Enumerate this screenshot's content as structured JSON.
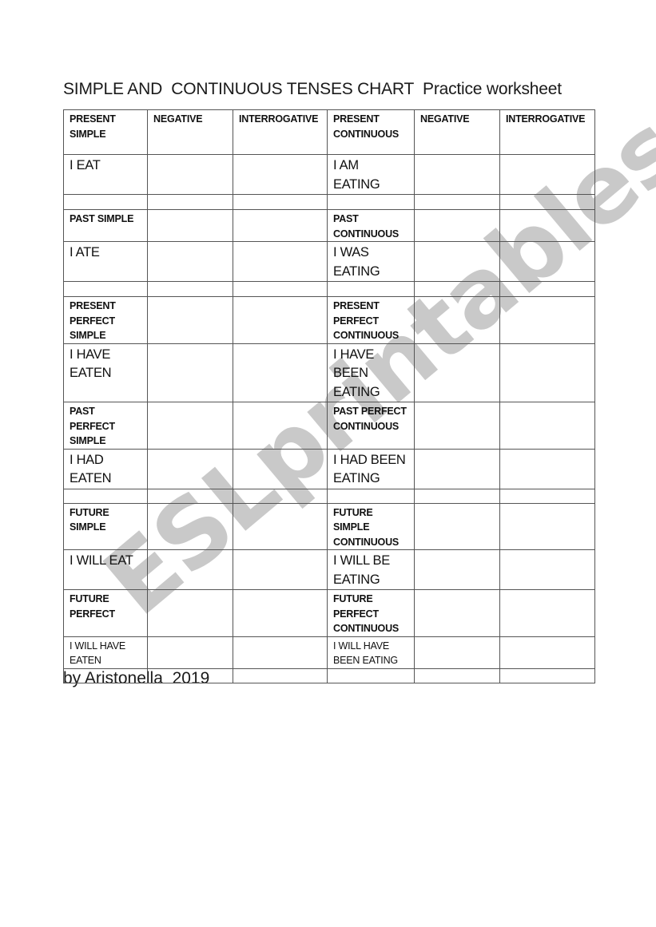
{
  "title": "SIMPLE AND  CONTINUOUS TENSES CHART  Practice worksheet",
  "watermark": "ESLprintables.com",
  "author": "by Aristonella  2019",
  "table": {
    "header": [
      "PRESENT SIMPLE",
      "NEGATIVE",
      "INTERROGATIVE",
      "PRESENT CONTINUOUS",
      "NEGATIVE",
      "INTERROGATIVE"
    ],
    "rows": [
      {
        "kind": "example",
        "cells": [
          "I EAT",
          "",
          "",
          "I AM EATING",
          "",
          ""
        ]
      },
      {
        "kind": "spacer",
        "cells": [
          "",
          "",
          "",
          "",
          "",
          ""
        ]
      },
      {
        "kind": "heading",
        "cells": [
          "PAST SIMPLE",
          "",
          "",
          "PAST CONTINUOUS",
          "",
          ""
        ]
      },
      {
        "kind": "example",
        "cells": [
          "I ATE",
          "",
          "",
          "I WAS EATING",
          "",
          ""
        ]
      },
      {
        "kind": "spacer",
        "cells": [
          "",
          "",
          "",
          "",
          "",
          ""
        ]
      },
      {
        "kind": "heading",
        "cells": [
          "PRESENT PERFECT SIMPLE",
          "",
          "",
          "PRESENT PERFECT CONTINUOUS",
          "",
          ""
        ]
      },
      {
        "kind": "example",
        "cells": [
          "I HAVE EATEN",
          "",
          "",
          "I HAVE BEEN EATING",
          "",
          ""
        ]
      },
      {
        "kind": "heading",
        "cells": [
          "PAST PERFECT SIMPLE",
          "",
          "",
          "PAST PERFECT CONTINUOUS",
          "",
          ""
        ]
      },
      {
        "kind": "example",
        "cells": [
          "I HAD EATEN",
          "",
          "",
          "I HAD BEEN EATING",
          "",
          ""
        ]
      },
      {
        "kind": "spacer",
        "cells": [
          "",
          "",
          "",
          "",
          "",
          ""
        ]
      },
      {
        "kind": "heading",
        "cells": [
          "FUTURE SIMPLE",
          "",
          "",
          "FUTURE SIMPLE CONTINUOUS",
          "",
          ""
        ]
      },
      {
        "kind": "example",
        "cells": [
          "I WILL EAT",
          "",
          "",
          "I WILL BE EATING",
          "",
          ""
        ]
      },
      {
        "kind": "heading",
        "cells": [
          "FUTURE PERFECT",
          "",
          "",
          "FUTURE PERFECT CONTINUOUS",
          "",
          ""
        ]
      },
      {
        "kind": "example-small",
        "cells": [
          "I WILL HAVE EATEN",
          "",
          "",
          "I WILL HAVE BEEN EATING",
          "",
          ""
        ]
      },
      {
        "kind": "spacer",
        "cells": [
          "",
          "",
          "",
          "",
          "",
          ""
        ]
      }
    ]
  }
}
